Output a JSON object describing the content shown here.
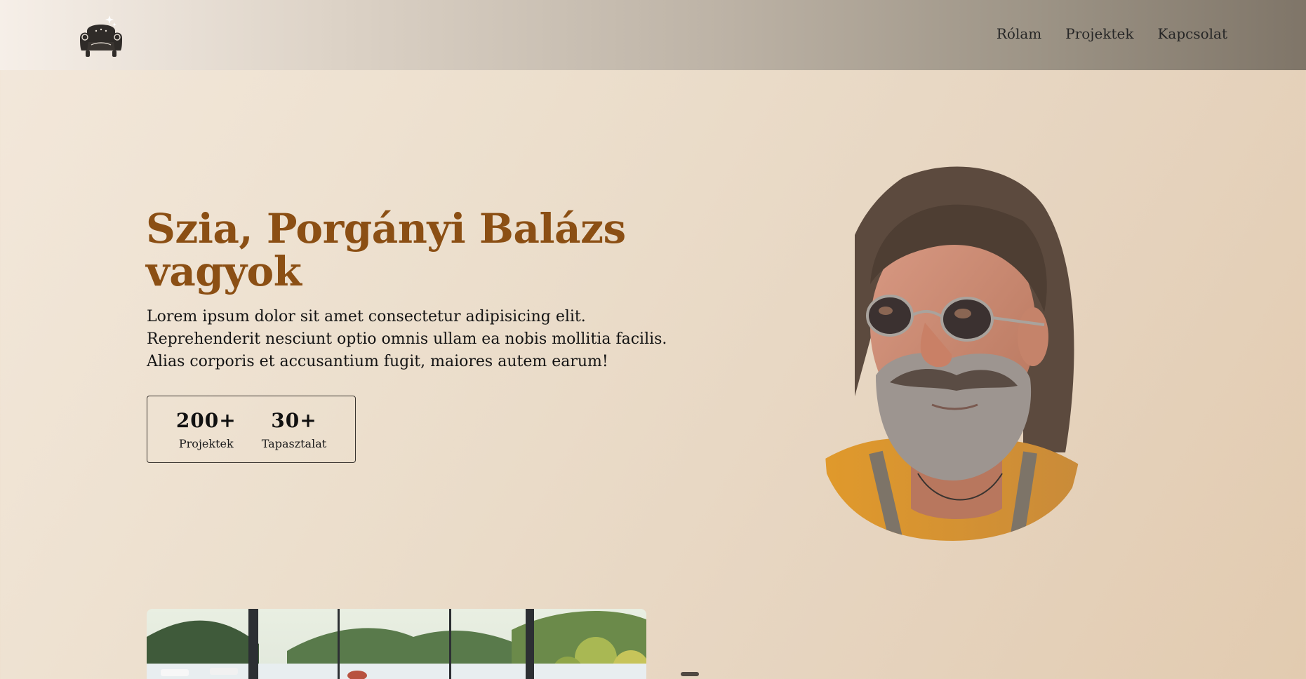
{
  "header": {
    "logo_icon": "armchair-logo-icon",
    "nav": [
      {
        "label": "Rólam"
      },
      {
        "label": "Projektek"
      },
      {
        "label": "Kapcsolat"
      }
    ]
  },
  "hero": {
    "title": "Szia, Porgányi Balázs vagyok",
    "description": "Lorem ipsum dolor sit amet consectetur adipisicing elit. Reprehenderit nesciunt optio omnis ullam ea nobis mollitia facilis. Alias corporis et accusantium fugit, maiores autem earum!",
    "stats": [
      {
        "value": "200+",
        "label": "Projektek"
      },
      {
        "value": "30+",
        "label": "Tapasztalat"
      }
    ],
    "portrait_icon": "portrait-photo"
  },
  "preview": {
    "image_icon": "lake-landscape-photo"
  },
  "colors": {
    "accent": "#8b4f14",
    "text": "#141414",
    "background": "#ecdfcd"
  }
}
